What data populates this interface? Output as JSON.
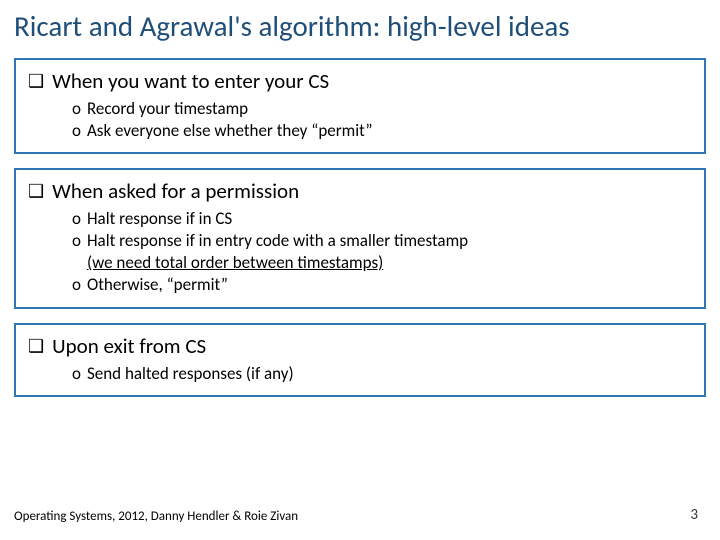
{
  "title": "Ricart and Agrawal's algorithm: high-level ideas",
  "boxes": [
    {
      "heading": "When you want to enter your CS",
      "items": [
        "Record your timestamp",
        "Ask everyone else whether they “permit”"
      ]
    },
    {
      "heading": "When asked for a permission",
      "items": [
        "Halt response if in CS",
        "Halt response if in entry code with a smaller timestamp",
        "Otherwise, “permit”"
      ],
      "underline_note": "(we need total order between timestamps)"
    },
    {
      "heading": "Upon exit from CS",
      "items": [
        "Send halted responses (if any)"
      ]
    }
  ],
  "footer": "Operating Systems, 2012, Danny Hendler & Roie Zivan",
  "page_number": "3",
  "bullet_square": "❑",
  "bullet_o": "o"
}
